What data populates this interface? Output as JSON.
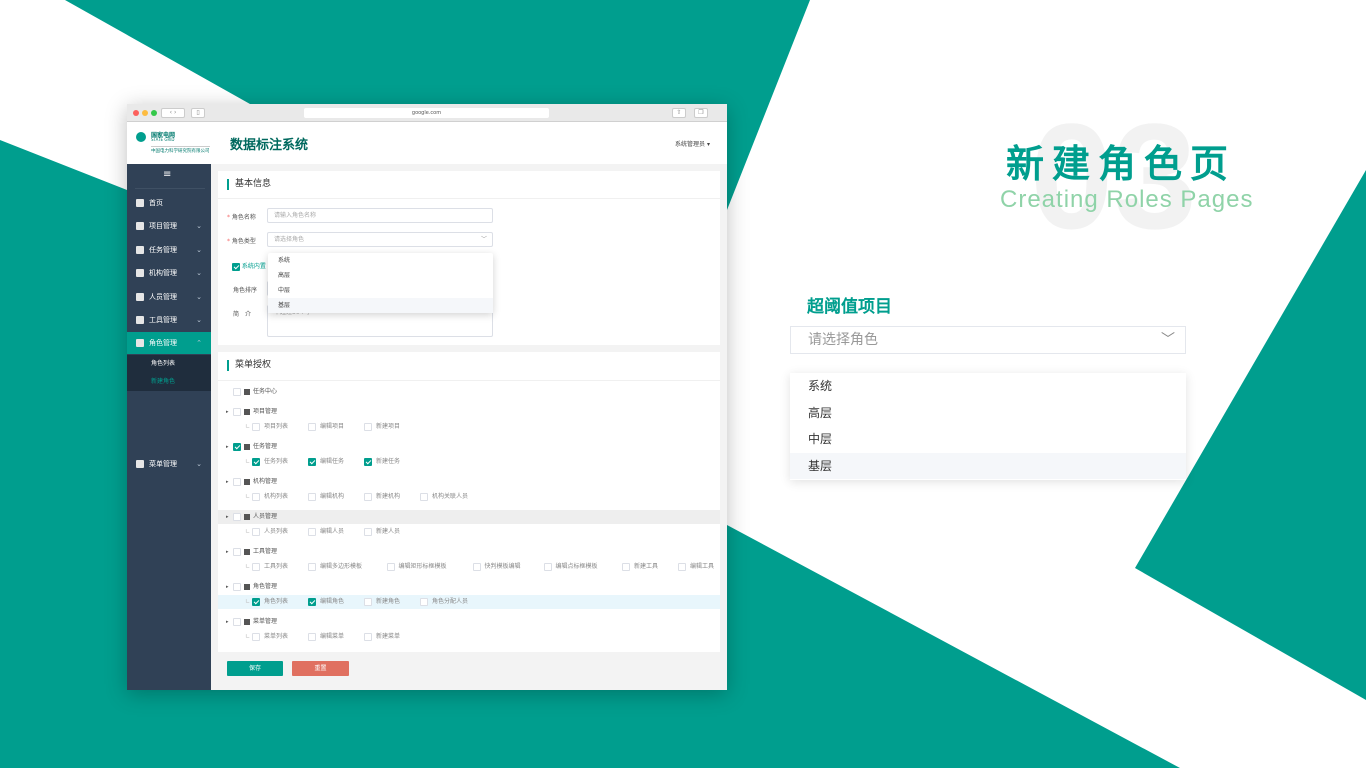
{
  "colors": {
    "accent": "#009e8e",
    "sidebar": "#304156",
    "reset": "#e07060",
    "subtitle": "#8fd3a8"
  },
  "slide": {
    "title": "新建角色页",
    "subtitle": "Creating Roles Pages",
    "watermark": "03"
  },
  "zoom_panel": {
    "label": "超阈值项目",
    "placeholder": "请选择角色",
    "options": [
      "系统",
      "高层",
      "中层",
      "基层"
    ]
  },
  "browser": {
    "url": "google.com"
  },
  "header": {
    "logo_text": "国家电网",
    "logo_sub": "STATE GRID",
    "logo_company": "中国电力科学研究院有限公司",
    "app_title": "数据标注系统",
    "user": "系统管理员"
  },
  "sidebar": {
    "items": [
      {
        "label": "首页",
        "icon": "home-icon"
      },
      {
        "label": "项目管理",
        "icon": "project-icon",
        "chev": "⌄"
      },
      {
        "label": "任务管理",
        "icon": "task-icon",
        "chev": "⌄"
      },
      {
        "label": "机构管理",
        "icon": "org-icon",
        "chev": "⌄"
      },
      {
        "label": "人员管理",
        "icon": "people-icon",
        "chev": "⌄"
      },
      {
        "label": "工具管理",
        "icon": "gear-icon",
        "chev": "⌄"
      },
      {
        "label": "角色管理",
        "icon": "shield-icon",
        "chev": "⌃",
        "active": true
      },
      {
        "label": "菜单管理",
        "icon": "menu-icon",
        "chev": "⌄"
      }
    ],
    "sub_items": [
      "角色列表",
      "新建角色"
    ]
  },
  "basic": {
    "title": "基本信息",
    "name_label": "角色名称",
    "name_placeholder": "请输入角色名称",
    "type_label": "角色类型",
    "type_placeholder": "请选择角色",
    "builtin_label": "系统内置",
    "sort_label": "角色排序",
    "intro_label": "简　介",
    "intro_placeholder": "不超过50个字",
    "options": [
      "系统",
      "高层",
      "中层",
      "基层"
    ]
  },
  "menu_auth": {
    "title": "菜单授权",
    "tree": [
      {
        "label": "任务中心",
        "checked": false,
        "children": []
      },
      {
        "label": "项目管理",
        "checked": false,
        "children": [
          [
            "项目列表",
            false
          ],
          [
            "编辑项目",
            false
          ],
          [
            "新建项目",
            false
          ]
        ]
      },
      {
        "label": "任务管理",
        "checked": true,
        "children": [
          [
            "任务列表",
            true
          ],
          [
            "编辑任务",
            true
          ],
          [
            "新建任务",
            true
          ]
        ]
      },
      {
        "label": "机构管理",
        "checked": false,
        "children": [
          [
            "机构列表",
            false
          ],
          [
            "编辑机构",
            false
          ],
          [
            "新建机构",
            false
          ],
          [
            "机构关联人员",
            false
          ]
        ]
      },
      {
        "label": "人员管理",
        "checked": false,
        "hover": true,
        "children": [
          [
            "人员列表",
            false
          ],
          [
            "编辑人员",
            false
          ],
          [
            "新建人员",
            false
          ]
        ]
      },
      {
        "label": "工具管理",
        "checked": false,
        "children": [
          [
            "工具列表",
            false
          ],
          [
            "编辑多边形模板",
            false
          ],
          [
            "编辑矩形标框模板",
            false
          ],
          [
            "快判模板编辑",
            false
          ],
          [
            "编辑点标框模板",
            false
          ],
          [
            "新建工具",
            false
          ],
          [
            "编辑工具",
            false
          ]
        ]
      },
      {
        "label": "角色管理",
        "checked": false,
        "children": [
          [
            "角色列表",
            true
          ],
          [
            "编辑角色",
            true
          ],
          [
            "新建角色",
            false
          ],
          [
            "角色分配人员",
            false
          ]
        ],
        "child_hl": true
      },
      {
        "label": "菜单管理",
        "checked": false,
        "children": [
          [
            "菜单列表",
            false
          ],
          [
            "编辑菜单",
            false
          ],
          [
            "新建菜单",
            false
          ]
        ]
      }
    ]
  },
  "actions": {
    "save": "保存",
    "reset": "重置"
  }
}
